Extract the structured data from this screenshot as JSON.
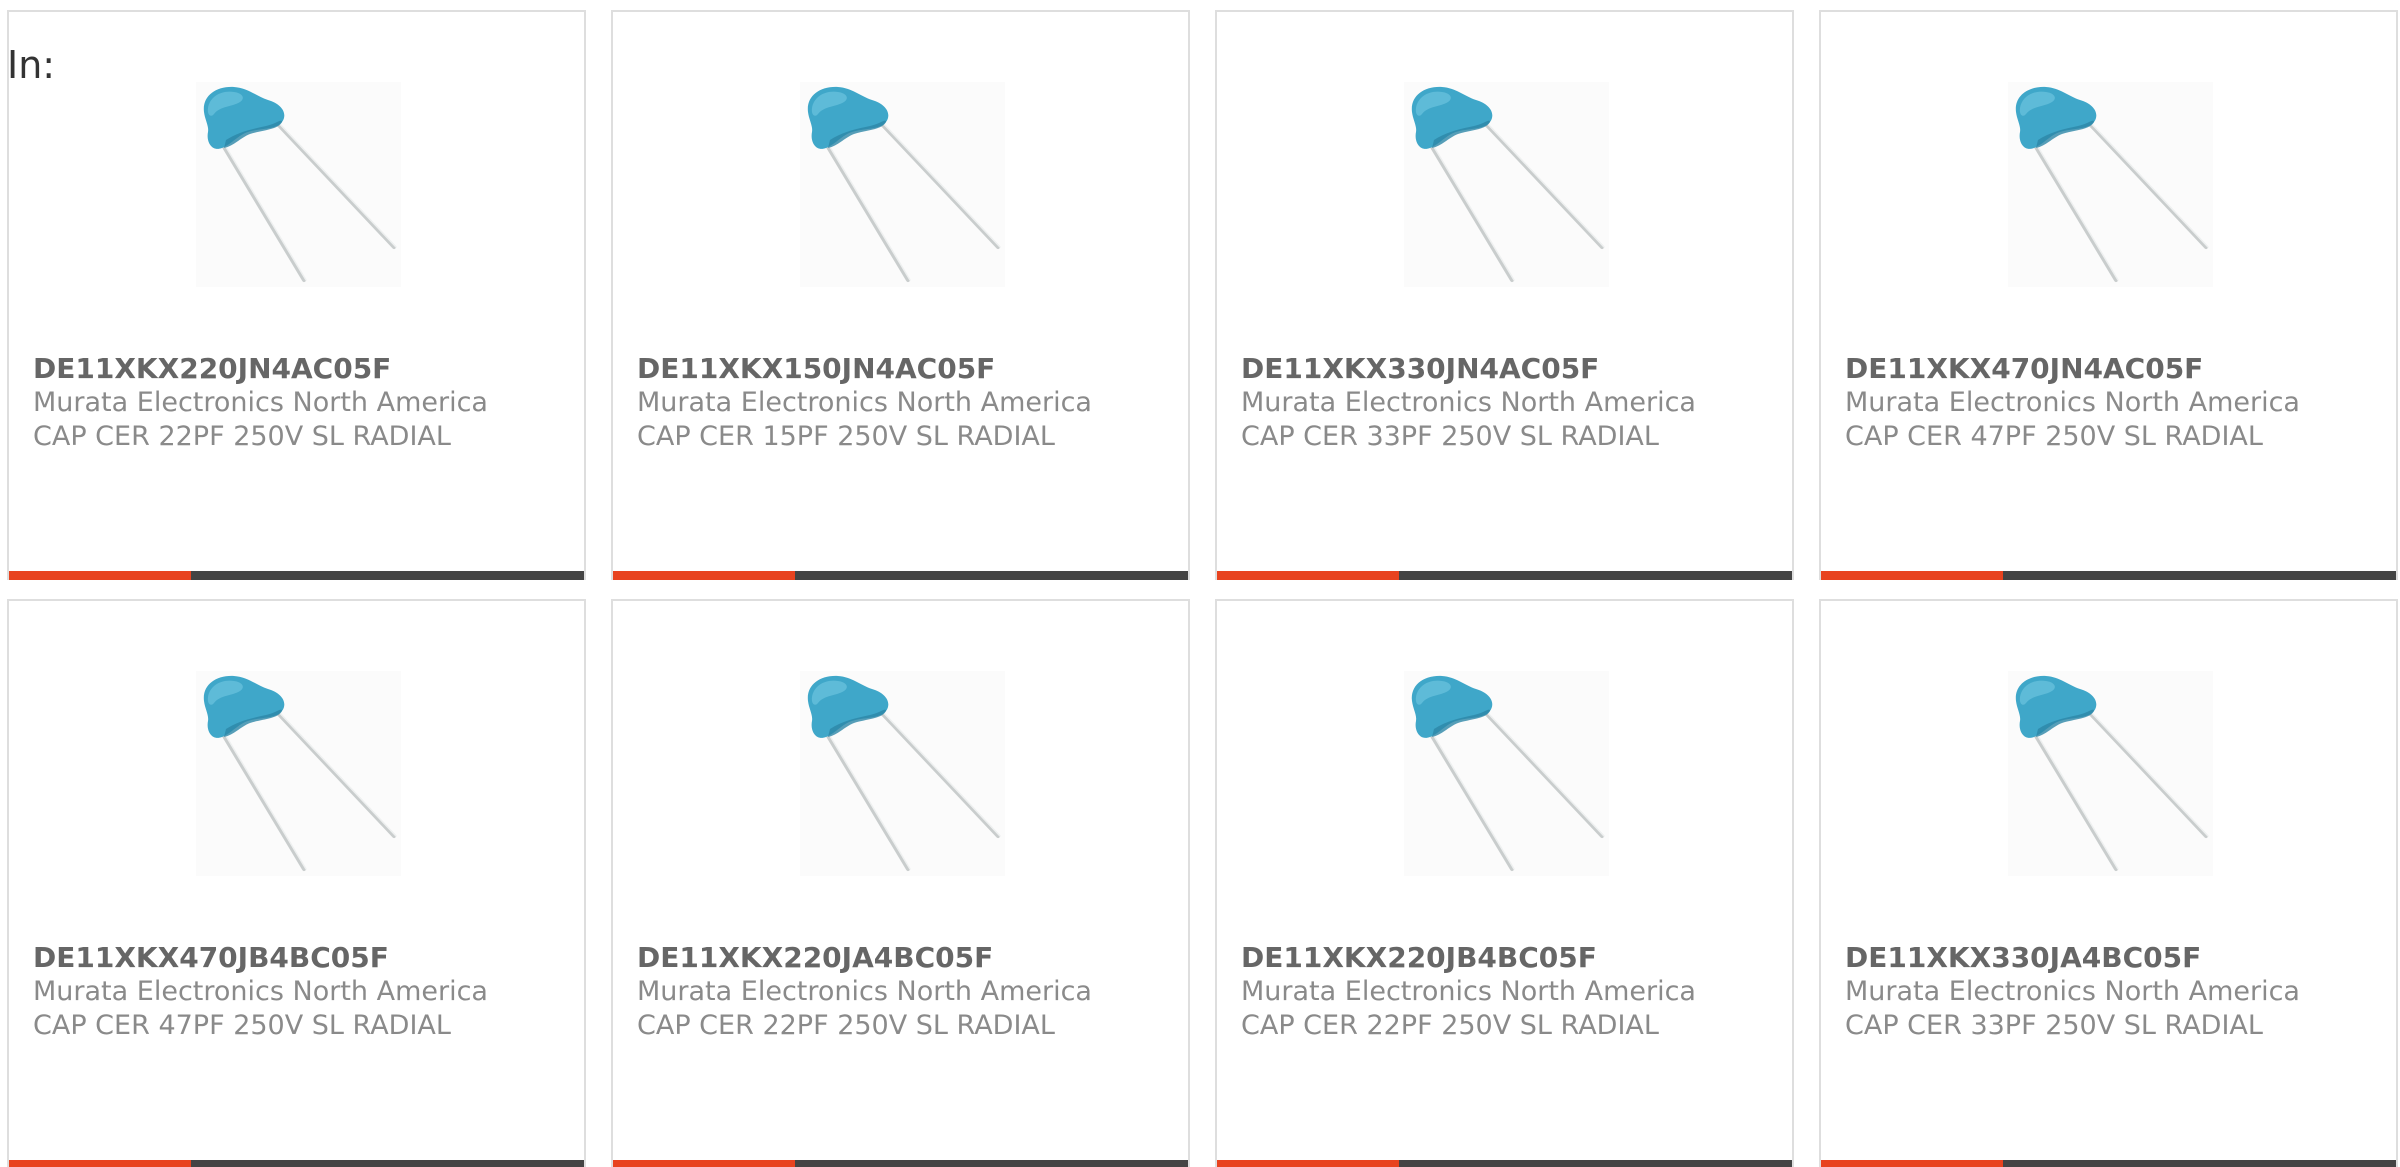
{
  "header": {
    "label": "In:"
  },
  "colors": {
    "accent": "#e8431f",
    "bar": "#444444",
    "capacitor_body": "#3fa7c9"
  },
  "products": [
    {
      "part_number": "DE11XKX220JN4AC05F",
      "manufacturer": "Murata Electronics North America",
      "description": "CAP CER 22PF 250V SL RADIAL",
      "icon": "ceramic-capacitor-image"
    },
    {
      "part_number": "DE11XKX150JN4AC05F",
      "manufacturer": "Murata Electronics North America",
      "description": "CAP CER 15PF 250V SL RADIAL",
      "icon": "ceramic-capacitor-image"
    },
    {
      "part_number": "DE11XKX330JN4AC05F",
      "manufacturer": "Murata Electronics North America",
      "description": "CAP CER 33PF 250V SL RADIAL",
      "icon": "ceramic-capacitor-image"
    },
    {
      "part_number": "DE11XKX470JN4AC05F",
      "manufacturer": "Murata Electronics North America",
      "description": "CAP CER 47PF 250V SL RADIAL",
      "icon": "ceramic-capacitor-image"
    },
    {
      "part_number": "DE11XKX470JB4BC05F",
      "manufacturer": "Murata Electronics North America",
      "description": "CAP CER 47PF 250V SL RADIAL",
      "icon": "ceramic-capacitor-image"
    },
    {
      "part_number": "DE11XKX220JA4BC05F",
      "manufacturer": "Murata Electronics North America",
      "description": "CAP CER 22PF 250V SL RADIAL",
      "icon": "ceramic-capacitor-image"
    },
    {
      "part_number": "DE11XKX220JB4BC05F",
      "manufacturer": "Murata Electronics North America",
      "description": "CAP CER 22PF 250V SL RADIAL",
      "icon": "ceramic-capacitor-image"
    },
    {
      "part_number": "DE11XKX330JA4BC05F",
      "manufacturer": "Murata Electronics North America",
      "description": "CAP CER 33PF 250V SL RADIAL",
      "icon": "ceramic-capacitor-image"
    }
  ]
}
